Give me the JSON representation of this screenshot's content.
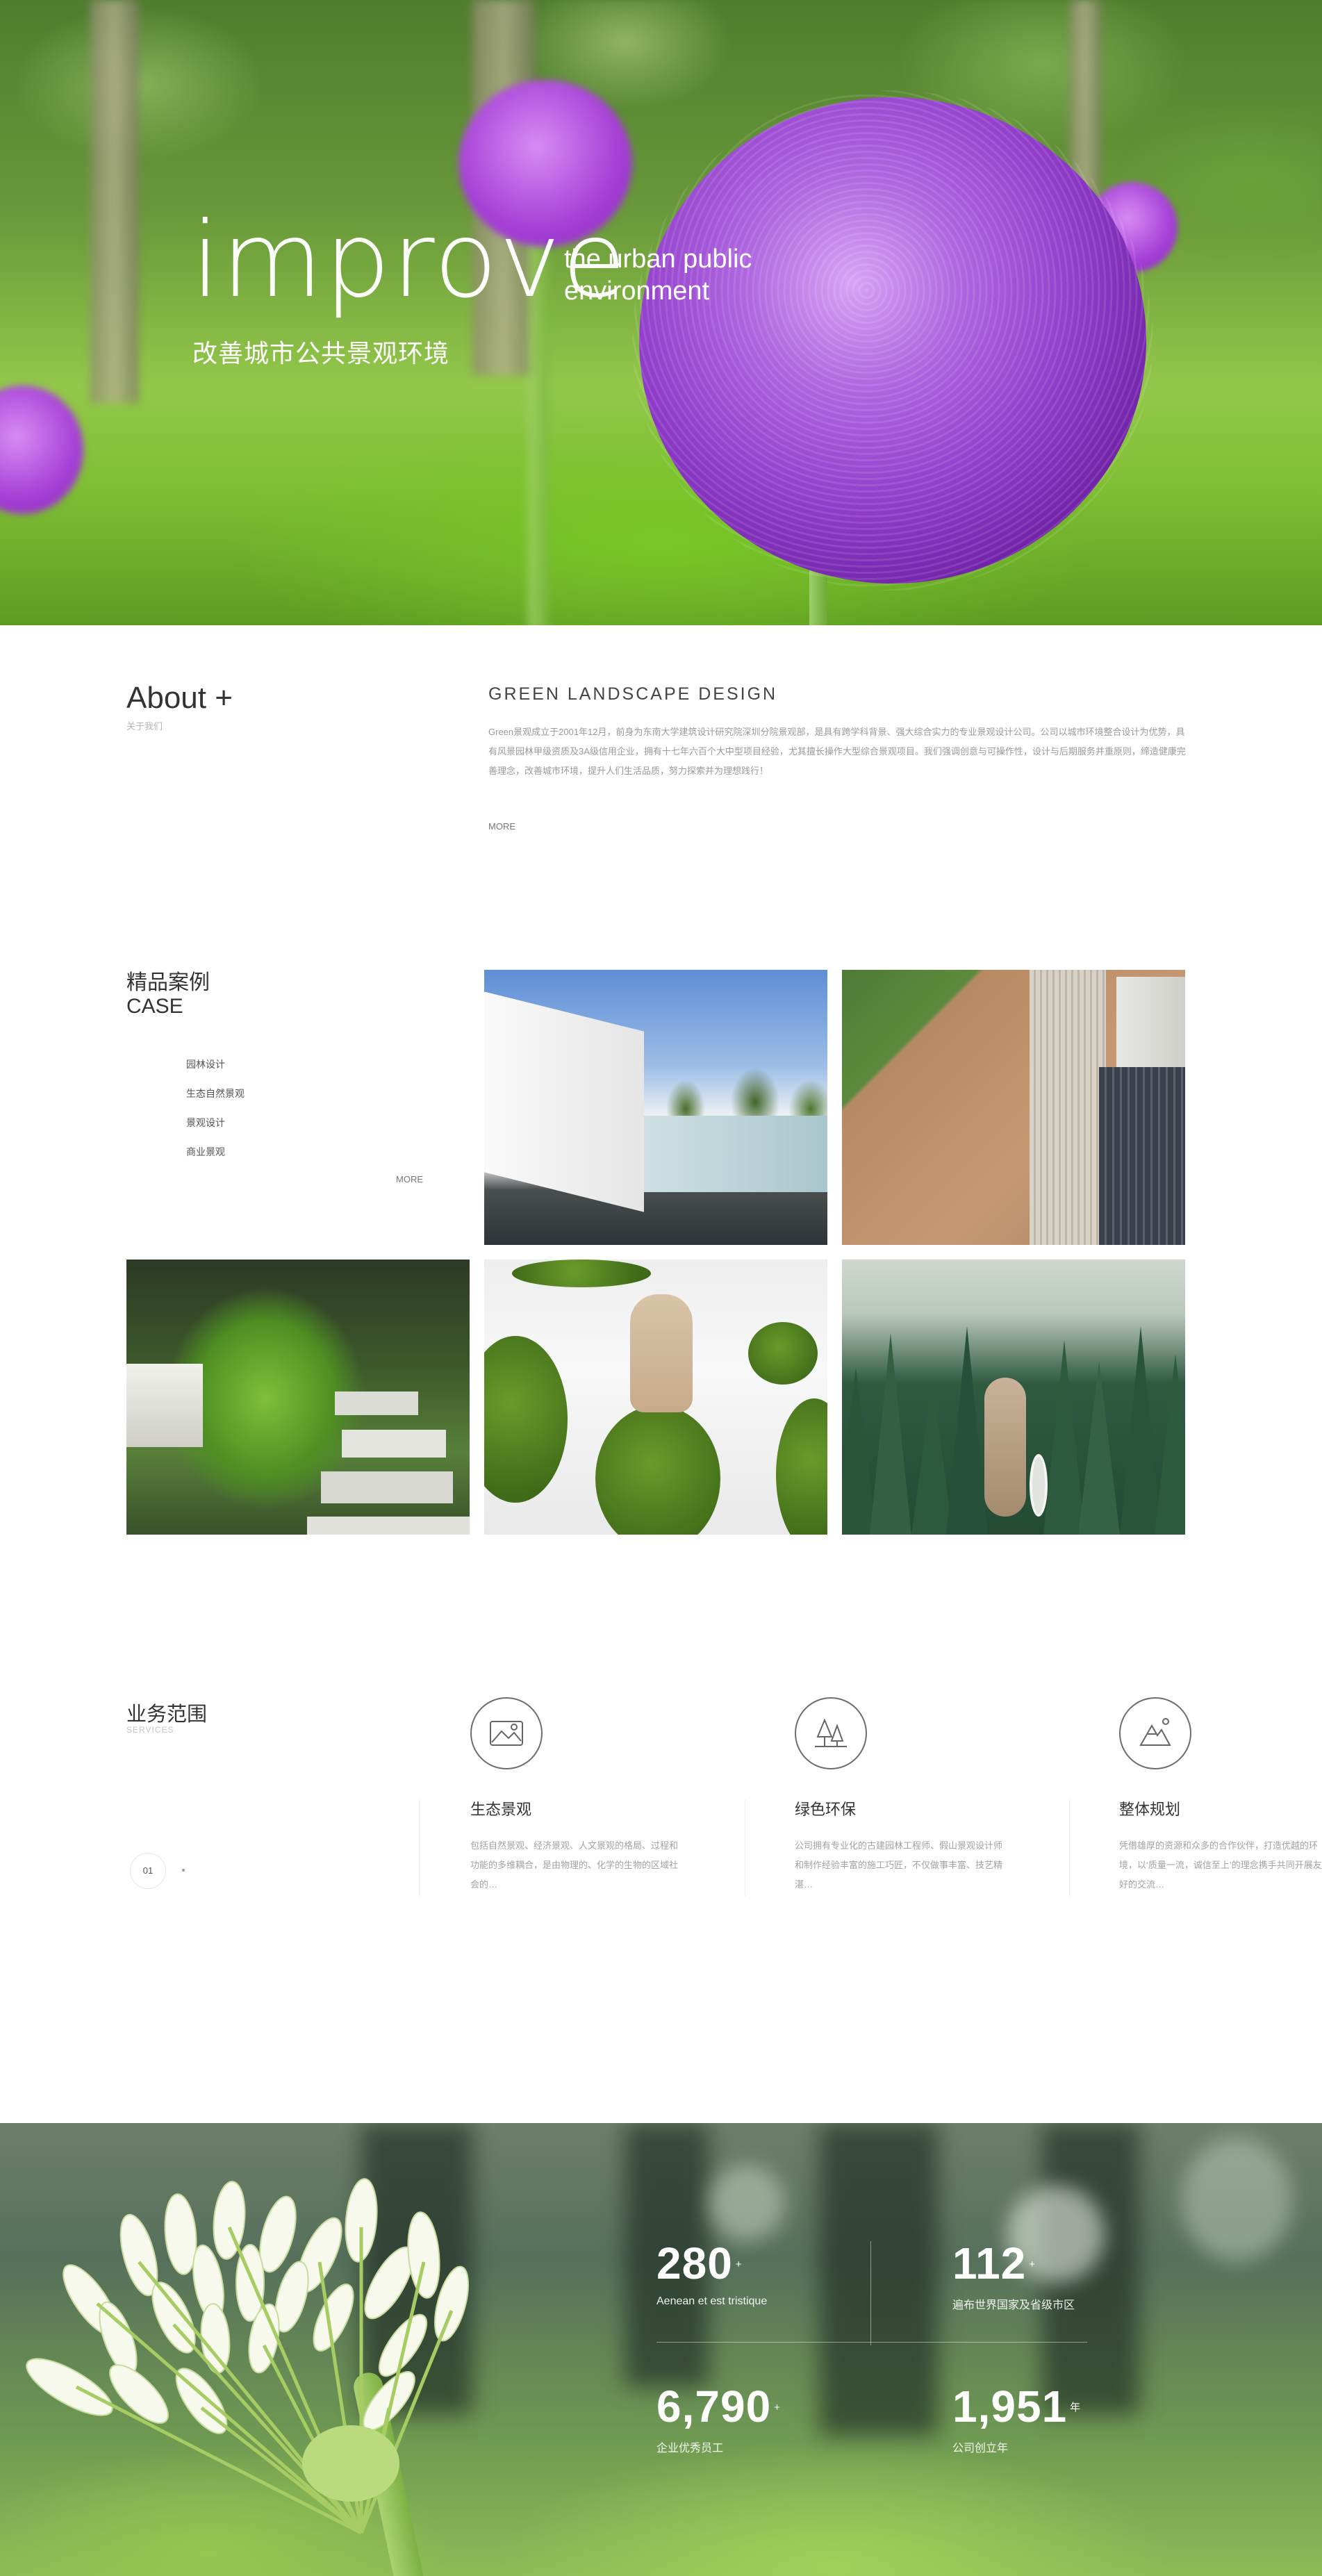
{
  "hero": {
    "big_word": "improve",
    "sub_line1": "the urban public",
    "sub_line2": "environment",
    "cn_title": "改善城市公共景观环境"
  },
  "about": {
    "title": "About +",
    "subtitle": "关于我们",
    "heading": "GREEN  LANDSCAPE  DESIGN",
    "body": "Green景观成立于2001年12月，前身为东南大学建筑设计研究院深圳分院景观部，是具有跨学科背景、强大综合实力的专业景观设计公司。公司以城市环境整合设计为优势，具有风景园林甲级资质及3A级信用企业，拥有十七年六百个大中型项目经验，尤其擅长操作大型综合景观项目。我们强调创意与可操作性，设计与后期服务并重原则，缔造健康完善理念，改善城市环境，提升人们生活品质，努力探索并为理想践行！",
    "more": "MORE"
  },
  "cases": {
    "title_cn": "精品案例",
    "title_en": "CASE",
    "categories": [
      "园林设计",
      "生态自然景观",
      "景观设计",
      "商业景观"
    ],
    "more": "MORE"
  },
  "services": {
    "title": "业务范围",
    "subtitle": "SERVICES",
    "pager": "01",
    "items": [
      {
        "icon": "landscape-icon",
        "name": "生态景观",
        "desc": "包括自然景观、经济景观、人文景观的格局、过程和功能的多维耦合，是由物理的、化学的生物的区域社会的…"
      },
      {
        "icon": "trees-icon",
        "name": "绿色环保",
        "desc": "公司拥有专业化的古建园林工程师、假山景观设计师和制作经验丰富的施工巧匠，不仅做事丰富、技艺精湛…"
      },
      {
        "icon": "planning-icon",
        "name": "整体规划",
        "desc": "凭借雄厚的资源和众多的合作伙伴，打造优越的环境，以‘质量一流，诚信至上’的理念携手共同开展友好的交流…"
      }
    ]
  },
  "stats": {
    "items": [
      {
        "num": "280",
        "sup": "+",
        "label": "Aenean et est tristique"
      },
      {
        "num": "112",
        "sup": "+",
        "label": "遍布世界国家及省级市区"
      },
      {
        "num": "6,790",
        "sup": "+",
        "label": "企业优秀员工"
      },
      {
        "num": "1,951",
        "sup": "年",
        "label": "公司创立年"
      }
    ]
  },
  "colors": {
    "accent_purple": "#9b3fd0",
    "text_dark": "#333333",
    "text_muted": "#9a9a9a"
  }
}
